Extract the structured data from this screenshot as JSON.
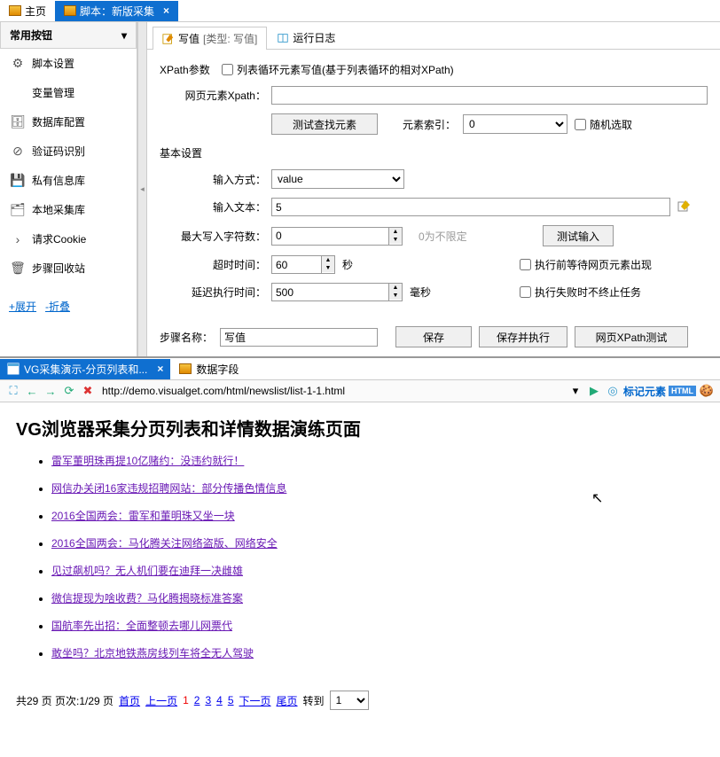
{
  "tabs": {
    "home": "主页",
    "script": "脚本：新版采集"
  },
  "sidebar": {
    "header": "常用按钮",
    "items": [
      {
        "icon": "⚙",
        "label": "脚本设置"
      },
      {
        "icon": "</>",
        "label": "变量管理"
      },
      {
        "icon": "🗄",
        "label": "数据库配置"
      },
      {
        "icon": "⊘",
        "label": "验证码识别"
      },
      {
        "icon": "💾",
        "label": "私有信息库"
      },
      {
        "icon": "🗂",
        "label": "本地采集库"
      },
      {
        "icon": "›",
        "label": "请求Cookie"
      },
      {
        "icon": "🗑",
        "label": "步骤回收站"
      }
    ],
    "expand": "+展开",
    "collapse": "-折叠"
  },
  "subtabs": {
    "write": "写值",
    "type_lbl": "[类型: 写值]",
    "log": "运行日志"
  },
  "form": {
    "xpath_group": "XPath参数",
    "loop_checkbox": "列表循环元素写值(基于列表循环的相对XPath)",
    "xpath_label": "网页元素Xpath：",
    "test_find": "测试查找元素",
    "elem_index_label": "元素索引：",
    "elem_index": "0",
    "random": "随机选取",
    "basic_group": "基本设置",
    "input_mode_label": "输入方式：",
    "input_mode": "value",
    "input_text_label": "输入文本：",
    "input_text": "5",
    "max_chars_label": "最大写入字符数：",
    "max_chars": "0",
    "max_chars_hint": "0为不限定",
    "test_input": "测试输入",
    "timeout_label": "超时时间：",
    "timeout": "60",
    "timeout_unit": "秒",
    "wait_checkbox": "执行前等待网页元素出现",
    "delay_label": "延迟执行时间：",
    "delay": "500",
    "delay_unit": "毫秒",
    "no_stop_checkbox": "执行失败时不终止任务",
    "step_name_label": "步骤名称：",
    "step_name": "写值",
    "save": "保存",
    "save_run": "保存并执行",
    "xpath_test": "网页XPath测试"
  },
  "browser": {
    "tab1": "VG采集演示-分页列表和...",
    "tab2": "数据字段",
    "url": "http://demo.visualget.com/html/newslist/list-1-1.html",
    "mark": "标记元素",
    "page_title": "VG浏览器采集分页列表和详情数据演练页面",
    "links": [
      "雷军董明珠再提10亿赌约：没违约就行！",
      "网信办关闭16家违规招聘网站：部分传播色情信息",
      "2016全国两会：雷军和董明珠又坐一块",
      "2016全国两会：马化腾关注网络盗版、网络安全",
      "见过飙机吗？无人机们要在迪拜一决雌雄",
      "微信提现为啥收费？马化腾揭晓标准答案",
      "国航率先出招：全面整顿去哪儿网票代",
      "敢坐吗？北京地铁燕房线列车将全无人驾驶"
    ],
    "pg_total": "共29 页 页次:1/29 页",
    "pg_first": "首页",
    "pg_prev": "上一页",
    "pg_next": "下一页",
    "pg_last": "尾页",
    "pg_goto": "转到",
    "pg_sel": "1"
  }
}
